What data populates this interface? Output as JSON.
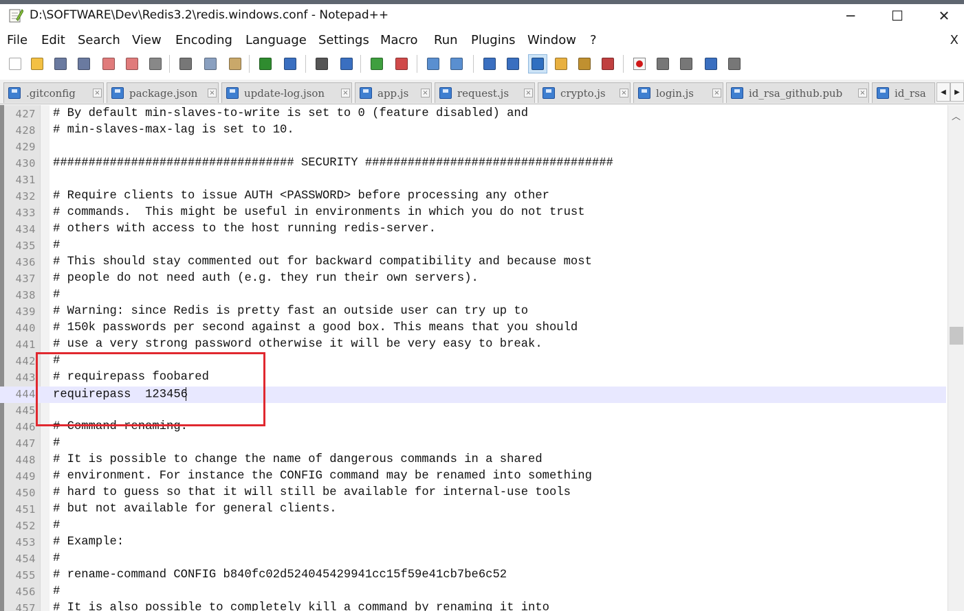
{
  "window": {
    "title": "D:\\SOFTWARE\\Dev\\Redis3.2\\redis.windows.conf - Notepad++",
    "minimize_icon": "minimize-icon",
    "maximize_icon": "maximize-icon",
    "close_icon": "close-icon",
    "minimize": "─",
    "maximize": "☐",
    "close": "✕"
  },
  "menu": {
    "items": [
      {
        "label": "File",
        "accel": "F"
      },
      {
        "label": "Edit",
        "accel": "E"
      },
      {
        "label": "Search",
        "accel": "S"
      },
      {
        "label": "View",
        "accel": "V"
      },
      {
        "label": "Encoding",
        "accel": "n"
      },
      {
        "label": "Language",
        "accel": "L"
      },
      {
        "label": "Settings",
        "accel": "t"
      },
      {
        "label": "Macro",
        "accel": "M"
      },
      {
        "label": "Run",
        "accel": "R"
      },
      {
        "label": "Plugins",
        "accel": "P"
      },
      {
        "label": "Window",
        "accel": "W"
      },
      {
        "label": "?",
        "accel": "?"
      }
    ],
    "close_doc": "X"
  },
  "toolbar": {
    "icons": [
      "new-file-icon",
      "open-file-icon",
      "save-icon",
      "save-all-icon",
      "close-icon",
      "close-all-icon",
      "print-icon",
      "cut-icon",
      "copy-icon",
      "paste-icon",
      "undo-icon",
      "redo-icon",
      "find-icon",
      "replace-icon",
      "zoom-in-icon",
      "zoom-out-icon",
      "sync-vertical-icon",
      "sync-horizontal-icon",
      "word-wrap-icon",
      "show-all-chars-icon",
      "indent-guide-icon",
      "user-language-icon",
      "doc-map-icon",
      "function-list-icon",
      "record-macro-icon",
      "stop-macro-icon",
      "play-macro-icon",
      "run-macro-multiple-icon",
      "save-macro-icon"
    ]
  },
  "tabs": [
    {
      "label": ".gitconfig"
    },
    {
      "label": "package.json"
    },
    {
      "label": "update-log.json"
    },
    {
      "label": "app.js"
    },
    {
      "label": "request.js"
    },
    {
      "label": "crypto.js"
    },
    {
      "label": "login.js"
    },
    {
      "label": "id_rsa_github.pub"
    },
    {
      "label": "id_rsa"
    }
  ],
  "tab_scroll": {
    "left": "◀",
    "right": "▶"
  },
  "editor": {
    "current_line": 444,
    "lines": [
      {
        "n": "427",
        "text": "# By default min-slaves-to-write is set to 0 (feature disabled) and"
      },
      {
        "n": "428",
        "text": "# min-slaves-max-lag is set to 10."
      },
      {
        "n": "429",
        "text": ""
      },
      {
        "n": "430",
        "text": "################################## SECURITY ###################################"
      },
      {
        "n": "431",
        "text": ""
      },
      {
        "n": "432",
        "text": "# Require clients to issue AUTH <PASSWORD> before processing any other"
      },
      {
        "n": "433",
        "text": "# commands.  This might be useful in environments in which you do not trust"
      },
      {
        "n": "434",
        "text": "# others with access to the host running redis-server."
      },
      {
        "n": "435",
        "text": "#"
      },
      {
        "n": "436",
        "text": "# This should stay commented out for backward compatibility and because most"
      },
      {
        "n": "437",
        "text": "# people do not need auth (e.g. they run their own servers)."
      },
      {
        "n": "438",
        "text": "#"
      },
      {
        "n": "439",
        "text": "# Warning: since Redis is pretty fast an outside user can try up to"
      },
      {
        "n": "440",
        "text": "# 150k passwords per second against a good box. This means that you should"
      },
      {
        "n": "441",
        "text": "# use a very strong password otherwise it will be very easy to break."
      },
      {
        "n": "442",
        "text": "#"
      },
      {
        "n": "443",
        "text": "# requirepass foobared"
      },
      {
        "n": "444",
        "text": "requirepass  123456"
      },
      {
        "n": "445",
        "text": ""
      },
      {
        "n": "446",
        "text": "# Command renaming."
      },
      {
        "n": "447",
        "text": "#"
      },
      {
        "n": "448",
        "text": "# It is possible to change the name of dangerous commands in a shared"
      },
      {
        "n": "449",
        "text": "# environment. For instance the CONFIG command may be renamed into something"
      },
      {
        "n": "450",
        "text": "# hard to guess so that it will still be available for internal-use tools"
      },
      {
        "n": "451",
        "text": "# but not available for general clients."
      },
      {
        "n": "452",
        "text": "#"
      },
      {
        "n": "453",
        "text": "# Example:"
      },
      {
        "n": "454",
        "text": "#"
      },
      {
        "n": "455",
        "text": "# rename-command CONFIG b840fc02d524045429941cc15f59e41cb7be6c52"
      },
      {
        "n": "456",
        "text": "#"
      },
      {
        "n": "457",
        "text": "# It is also possible to completely kill a command by renaming it into"
      }
    ]
  },
  "colors": {
    "current_line": "#e8e8ff",
    "highlight_box": "#e0282f",
    "gutter": "#e4e4e4"
  }
}
